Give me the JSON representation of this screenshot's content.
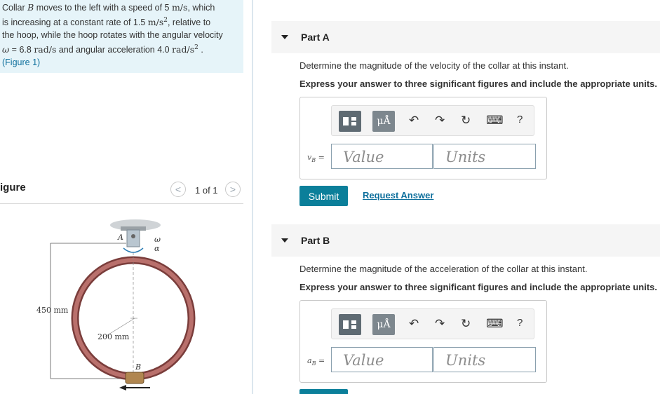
{
  "problem": {
    "line1_a": "Collar ",
    "line1_var": "B",
    "line1_b": " moves to the left with a speed of 5 ",
    "line1_unit": "m/s",
    "line1_c": ", which",
    "line2_a": "is increasing at a constant rate of 1.5 ",
    "line2_unit": "m/s",
    "line2_sup": "2",
    "line2_b": ", relative to",
    "line3": "the hoop, while the hoop rotates with the angular velocity",
    "line4_var": "ω",
    "line4_a": " = 6.8 ",
    "line4_unit": "rad/s",
    "line4_b": " and angular acceleration 4.0 ",
    "line4_unit2": "rad/s",
    "line4_sup": "2",
    "line4_c": " .",
    "figure_link": "(Figure 1)"
  },
  "figure": {
    "title": "igure",
    "pager": "1 of 1",
    "prev": "<",
    "next": ">",
    "labels": {
      "A": "A",
      "B": "B",
      "omega": "ω",
      "alpha": "α",
      "height": "450 mm",
      "radius": "200 mm"
    }
  },
  "partA": {
    "title": "Part A",
    "question": "Determine the magnitude of the velocity of the collar at this instant.",
    "instruction": "Express your answer to three significant figures and include the appropriate units.",
    "var_label": "v",
    "var_sub": "B",
    "var_eq": " =",
    "value_placeholder": "Value",
    "units_placeholder": "Units",
    "submit": "Submit",
    "request": "Request Answer"
  },
  "partB": {
    "title": "Part B",
    "question": "Determine the magnitude of the acceleration of the collar at this instant.",
    "instruction": "Express your answer to three significant figures and include the appropriate units.",
    "var_label": "a",
    "var_sub": "B",
    "var_eq": " =",
    "value_placeholder": "Value",
    "units_placeholder": "Units"
  },
  "toolbar": {
    "mu_label": "μÅ",
    "undo": "↶",
    "redo": "↷",
    "reset": "↻",
    "keyboard": "⌨",
    "help": "?"
  }
}
